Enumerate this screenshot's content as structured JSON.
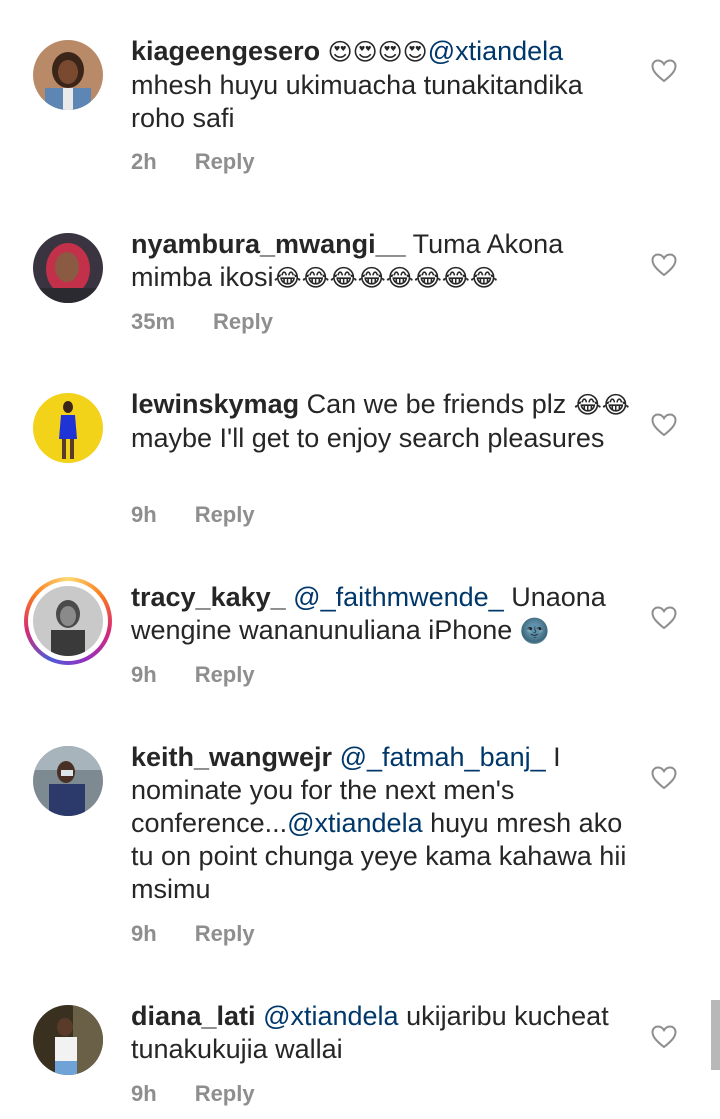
{
  "comments": [
    {
      "username": "kiageengesero",
      "text_line1_emoji": "😍😍😍😍",
      "mention": "@xtiandela",
      "text_rest": "mhesh huyu ukimuacha tunakitandika roho safi",
      "time": "2h",
      "reply_label": "Reply"
    },
    {
      "username": "nyambura_mwangi__",
      "text": "Tuma Akona mimba ikosi",
      "emoji": "😂😂😂😂😂😂😂😂",
      "time": "35m",
      "reply_label": "Reply"
    },
    {
      "username": "lewinskymag",
      "text_a": "Can we be friends plz",
      "emoji": "😂😂",
      "text_b": "maybe I'll get to enjoy search pleasures",
      "time": "9h",
      "reply_label": "Reply"
    },
    {
      "username": "tracy_kaky_",
      "mention": "@_faithmwende_",
      "text": "Unaona wengine wananunuliana iPhone",
      "emoji": "🌚",
      "time": "9h",
      "reply_label": "Reply"
    },
    {
      "username": "keith_wangwejr",
      "mention": "@_fatmah_banj_",
      "text_a": "I nominate you for the next men's conference...",
      "mention2": "@xtiandela",
      "text_b": "huyu mresh ako tu on point chunga yeye kama kahawa hii msimu",
      "time": "9h",
      "reply_label": "Reply"
    },
    {
      "username": "diana_lati",
      "mention": "@xtiandela",
      "text": "ukijaribu kucheat tunakukujia wallai",
      "time": "9h",
      "reply_label": "Reply"
    }
  ],
  "icons": {
    "like": "heart-outline-icon"
  },
  "colors": {
    "text": "#262626",
    "meta": "#8e8e8e",
    "mention": "#00376b",
    "background": "#ffffff"
  }
}
